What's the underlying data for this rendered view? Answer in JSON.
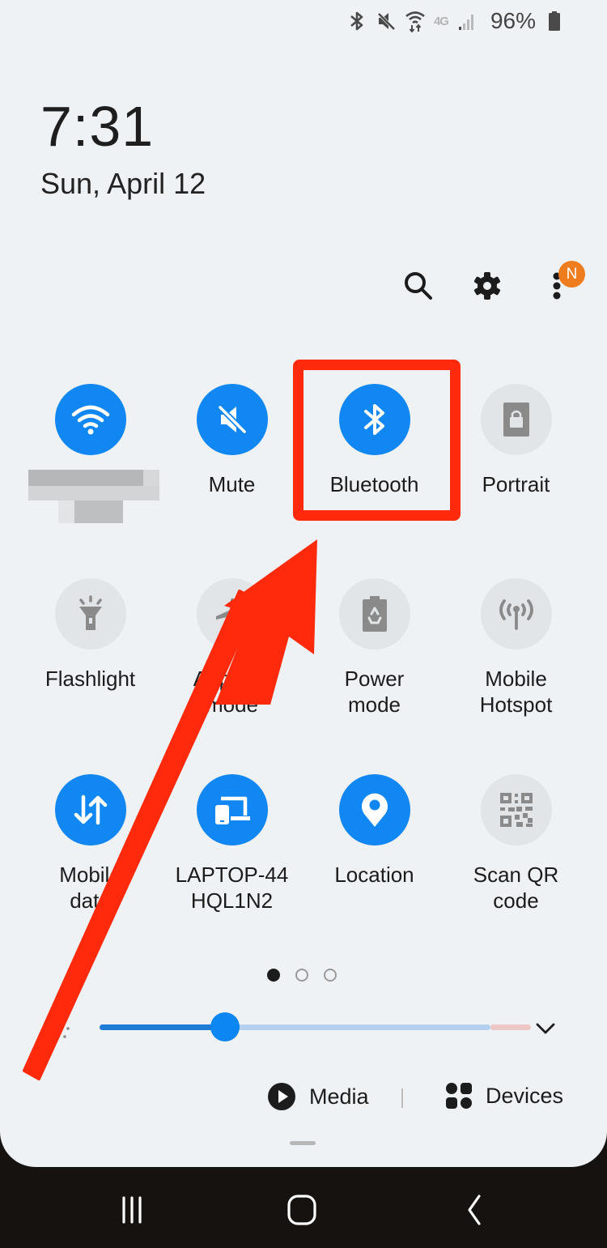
{
  "status_bar": {
    "icons": [
      "bluetooth-icon",
      "mute-icon",
      "wifi-data-icon",
      "lte-icon",
      "signal-icon",
      "battery-icon"
    ],
    "network_label": "4G",
    "battery_percent": "96%"
  },
  "clock": {
    "time": "7:31",
    "date": "Sun, April 12"
  },
  "top_actions": {
    "search": "search-icon",
    "settings": "gear-icon",
    "more": "more-vert-icon",
    "notification_badge": "N"
  },
  "tiles": [
    {
      "id": "wifi",
      "label": "",
      "label_obscured": true,
      "state": "on",
      "icon": "wifi-icon"
    },
    {
      "id": "mute",
      "label": "Mute",
      "state": "on",
      "icon": "mute-icon"
    },
    {
      "id": "bluetooth",
      "label": "Bluetooth",
      "state": "on",
      "icon": "bluetooth-icon"
    },
    {
      "id": "portrait",
      "label": "Portrait",
      "state": "off",
      "icon": "portrait-lock-icon"
    },
    {
      "id": "flashlight",
      "label": "Flashlight",
      "state": "off",
      "icon": "flashlight-icon"
    },
    {
      "id": "airplane",
      "label": "Airplane\nmode",
      "state": "off",
      "icon": "airplane-icon"
    },
    {
      "id": "power",
      "label": "Power\nmode",
      "state": "off",
      "icon": "power-mode-icon"
    },
    {
      "id": "hotspot",
      "label": "Mobile\nHotspot",
      "state": "off",
      "icon": "hotspot-icon"
    },
    {
      "id": "mobiledata",
      "label": "Mobile\ndata",
      "state": "on",
      "icon": "mobile-data-icon"
    },
    {
      "id": "laptop",
      "label": "LAPTOP-44\nHQL1N2",
      "state": "on",
      "icon": "link-to-pc-icon"
    },
    {
      "id": "location",
      "label": "Location",
      "state": "on",
      "icon": "location-pin-icon"
    },
    {
      "id": "qr",
      "label": "Scan QR\ncode",
      "state": "off",
      "icon": "qr-code-icon"
    }
  ],
  "pager": {
    "pages": 3,
    "current": 1
  },
  "brightness": {
    "level_percent": 32
  },
  "bottom": {
    "media_label": "Media",
    "devices_label": "Devices"
  },
  "navbar": {
    "recents": "recents-icon",
    "home": "home-icon",
    "back": "back-icon"
  },
  "annotation": {
    "highlight_target": "bluetooth",
    "color": "#ff2a0c"
  },
  "colors": {
    "tile_on": "#1187f3",
    "tile_off": "#e2e5e7",
    "badge": "#ef7d1e",
    "panel_bg": "#eff2f4"
  }
}
